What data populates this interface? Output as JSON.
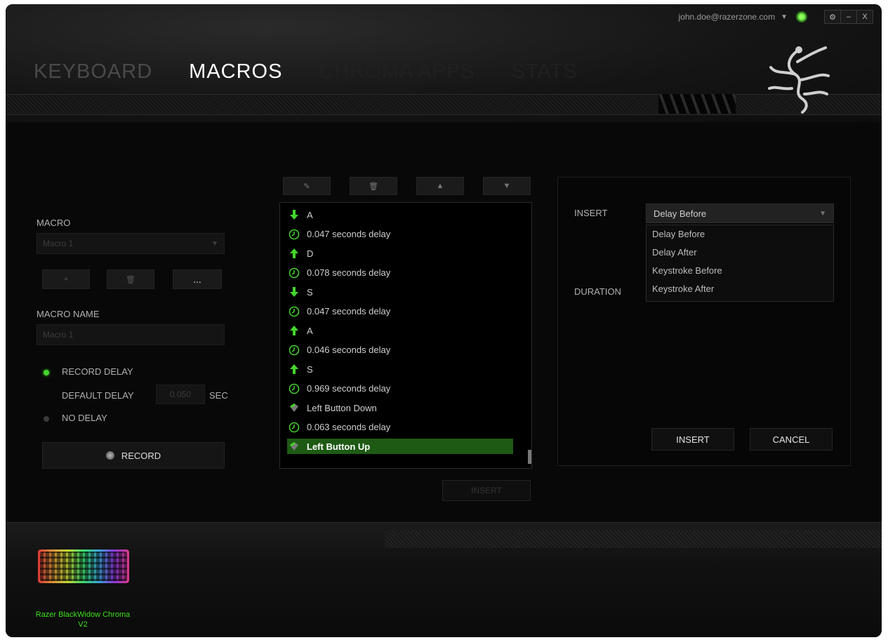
{
  "topbar": {
    "account": "john.doe@razerzone.com",
    "controls": [
      "⚙",
      "–",
      "X"
    ]
  },
  "nav": {
    "tabs": [
      "KEYBOARD",
      "MACROS",
      "CHROMA APPS",
      "STATS"
    ],
    "active": "MACROS"
  },
  "macro": {
    "label": "MACRO",
    "selected": "Macro 1",
    "actions": [
      "+",
      "🗑",
      "..."
    ],
    "name_label": "MACRO NAME",
    "name_value": "Macro 1",
    "record_delay_label": "RECORD DELAY",
    "default_delay_label": "DEFAULT DELAY",
    "default_delay_value": "0.050",
    "default_delay_unit": "SEC",
    "no_delay_label": "NO DELAY",
    "record_label": "RECORD"
  },
  "list": {
    "toolbar": [
      "✎",
      "🗑",
      "▲",
      "▼"
    ],
    "rows": [
      {
        "type": "down",
        "text": "A"
      },
      {
        "type": "delay",
        "text": "0.047 seconds delay"
      },
      {
        "type": "up",
        "text": "D"
      },
      {
        "type": "delay",
        "text": "0.078 seconds delay"
      },
      {
        "type": "down",
        "text": "S"
      },
      {
        "type": "delay",
        "text": "0.047 seconds delay"
      },
      {
        "type": "up",
        "text": "A"
      },
      {
        "type": "delay",
        "text": "0.046 seconds delay"
      },
      {
        "type": "up",
        "text": "S"
      },
      {
        "type": "delay",
        "text": "0.969 seconds delay"
      },
      {
        "type": "mouse",
        "text": "Left Button Down"
      },
      {
        "type": "delay",
        "text": "0.063 seconds delay"
      },
      {
        "type": "mouse",
        "text": "Left Button Up",
        "selected": true
      }
    ],
    "insert_label": "INSERT"
  },
  "panel": {
    "insert_label": "INSERT",
    "duration_label": "DURATION",
    "dropdown_value": "Delay Before",
    "options": [
      "Delay Before",
      "Delay After",
      "Keystroke Before",
      "Keystroke After"
    ],
    "insert_button": "INSERT",
    "cancel_button": "CANCEL"
  },
  "footer": {
    "device_name": "Razer BlackWidow Chroma V2"
  },
  "colors": {
    "accent": "#44d62c",
    "selected_row": "#1e5a14"
  }
}
